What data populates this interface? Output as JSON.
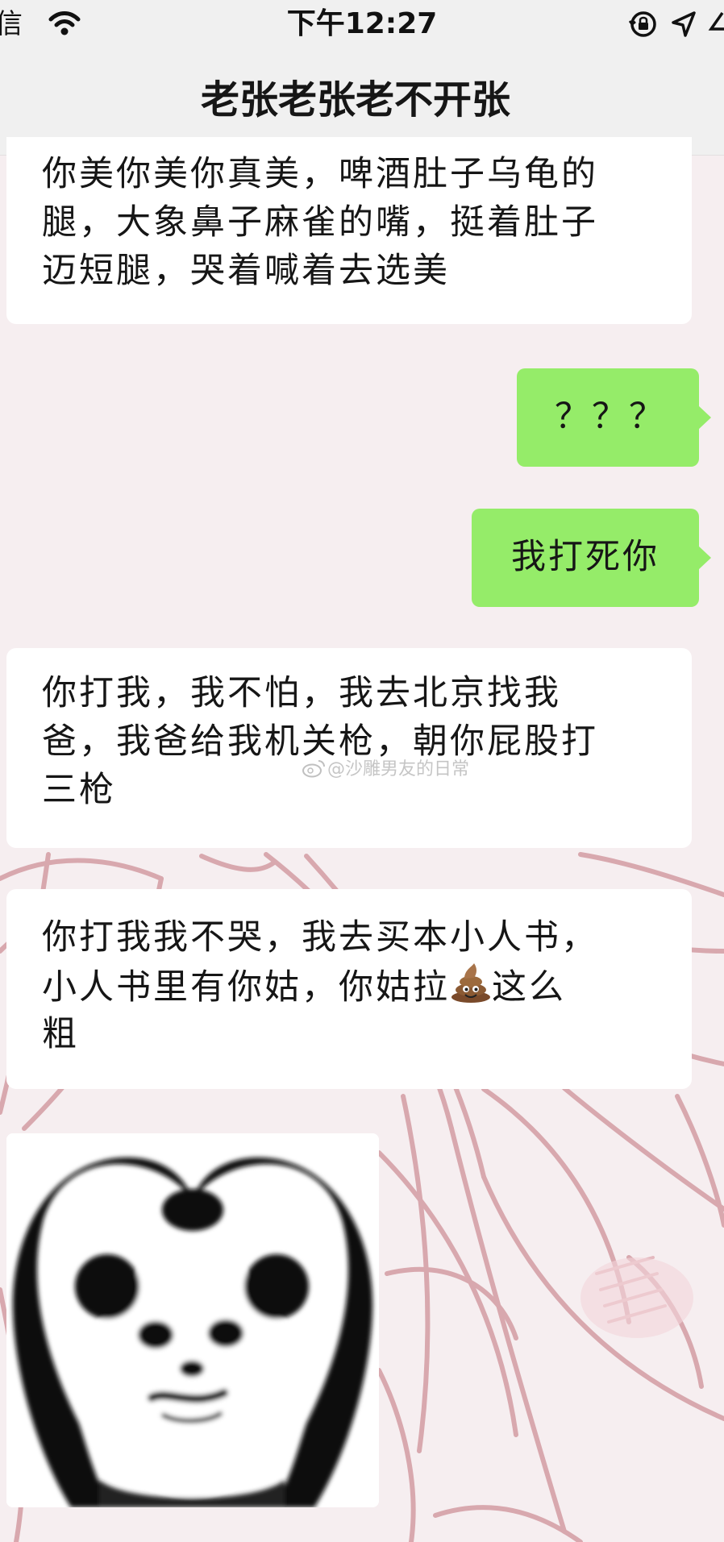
{
  "status_bar": {
    "carrier": "信",
    "time": "下午12:27"
  },
  "chat": {
    "title": "老张老张老不开张"
  },
  "messages": [
    {
      "side": "incoming",
      "lines": [
        "你美你美你真美，啤酒肚子乌龟的",
        "腿，大象鼻子麻雀的嘴，挺着肚子",
        "迈短腿，哭着喊着去选美"
      ]
    },
    {
      "side": "outgoing",
      "text": "？？？"
    },
    {
      "side": "outgoing",
      "text": "我打死你"
    },
    {
      "side": "incoming",
      "lines": [
        "你打我，我不怕，我去北京找我",
        "爸，我爸给我机关枪，朝你屁股打",
        "三枪"
      ]
    },
    {
      "side": "incoming",
      "lines": [
        "你打我我不哭，我去买本小人书，",
        "小人书里有你姑，你姑拉",
        "这么",
        "粗"
      ],
      "emoji": "pile-of-poo-emoji"
    }
  ],
  "sticker": {
    "type": "panda-head-heart-arms-meme",
    "icon": "panda-sticker"
  },
  "watermark": {
    "text": "@沙雕男友的日常",
    "icon": "weibo-icon"
  },
  "colors": {
    "background": "#f6eef0",
    "outgoing_bubble": "#95ec69",
    "incoming_bubble": "#ffffff",
    "bar_background": "#f0f0f0",
    "illustration_line": "#d8a8ae"
  },
  "icons": {
    "wifi": "wifi-icon",
    "orientation_lock": "orientation-lock-icon",
    "location": "location-arrow-icon",
    "battery": "battery-icon"
  }
}
